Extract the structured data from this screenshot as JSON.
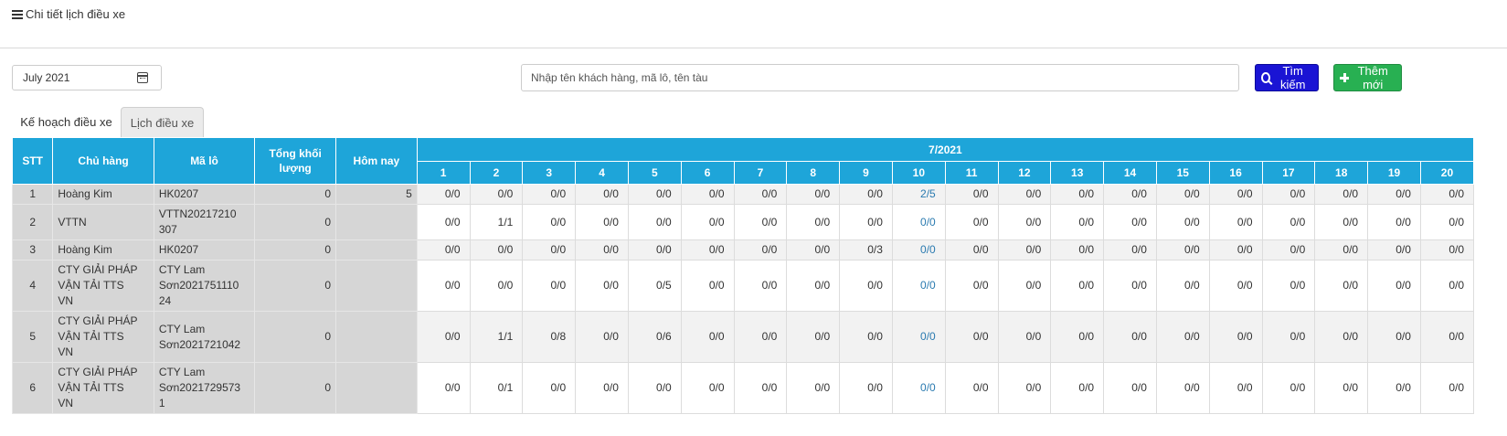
{
  "header": {
    "title": "Chi tiết lịch điều xe",
    "menu_icon": "hamburger-icon"
  },
  "toolbar": {
    "month_value": "July  2021",
    "calendar_icon": "calendar-icon",
    "search_placeholder": "Nhập tên khách hàng, mã lô, tên tàu",
    "search_label": "Tìm kiếm",
    "add_label": "Thêm mới"
  },
  "tabs": [
    {
      "label": "Kế hoạch điều xe",
      "active": false
    },
    {
      "label": "Lịch điều xe",
      "active": true
    }
  ],
  "colors": {
    "header_bg": "#1ea5d9",
    "search_btn": "#1a14d4",
    "add_btn": "#28b052",
    "link": "#2a7ab0",
    "info_bg": "#d6d6d6"
  },
  "table": {
    "columns": {
      "stt": "STT",
      "owner": "Chủ hàng",
      "lot": "Mã lô",
      "total_line1": "Tổng khối",
      "total_line2": "lượng",
      "today": "Hôm nay"
    },
    "month_label": "7/2021",
    "days": [
      "1",
      "2",
      "3",
      "4",
      "5",
      "6",
      "7",
      "8",
      "9",
      "10",
      "11",
      "12",
      "13",
      "14",
      "15",
      "16",
      "17",
      "18",
      "19",
      "20"
    ],
    "rows": [
      {
        "stt": "1",
        "owner": [
          "Hoàng Kim"
        ],
        "lot": [
          "HK0207"
        ],
        "total": "0",
        "today": "5",
        "cells": [
          "0/0",
          "0/0",
          "0/0",
          "0/0",
          "0/0",
          "0/0",
          "0/0",
          "0/0",
          "0/0",
          "2/5",
          "0/0",
          "0/0",
          "0/0",
          "0/0",
          "0/0",
          "0/0",
          "0/0",
          "0/0",
          "0/0",
          "0/0"
        ]
      },
      {
        "stt": "2",
        "owner": [
          "VTTN"
        ],
        "lot": [
          "VTTN20217210",
          "307"
        ],
        "total": "0",
        "today": "",
        "cells": [
          "0/0",
          "1/1",
          "0/0",
          "0/0",
          "0/0",
          "0/0",
          "0/0",
          "0/0",
          "0/0",
          "0/0",
          "0/0",
          "0/0",
          "0/0",
          "0/0",
          "0/0",
          "0/0",
          "0/0",
          "0/0",
          "0/0",
          "0/0"
        ]
      },
      {
        "stt": "3",
        "owner": [
          "Hoàng Kim"
        ],
        "lot": [
          "HK0207"
        ],
        "total": "0",
        "today": "",
        "cells": [
          "0/0",
          "0/0",
          "0/0",
          "0/0",
          "0/0",
          "0/0",
          "0/0",
          "0/0",
          "0/3",
          "0/0",
          "0/0",
          "0/0",
          "0/0",
          "0/0",
          "0/0",
          "0/0",
          "0/0",
          "0/0",
          "0/0",
          "0/0"
        ]
      },
      {
        "stt": "4",
        "owner": [
          "CTY GIẢI PHÁP",
          "VẬN TẢI TTS",
          "VN"
        ],
        "lot": [
          "CTY Lam",
          "Sơn2021751110",
          "24"
        ],
        "total": "0",
        "today": "",
        "cells": [
          "0/0",
          "0/0",
          "0/0",
          "0/0",
          "0/5",
          "0/0",
          "0/0",
          "0/0",
          "0/0",
          "0/0",
          "0/0",
          "0/0",
          "0/0",
          "0/0",
          "0/0",
          "0/0",
          "0/0",
          "0/0",
          "0/0",
          "0/0"
        ]
      },
      {
        "stt": "5",
        "owner": [
          "CTY GIẢI PHÁP",
          "VẬN TẢI TTS",
          "VN"
        ],
        "lot": [
          "CTY Lam",
          "Sơn2021721042"
        ],
        "total": "0",
        "today": "",
        "cells": [
          "0/0",
          "1/1",
          "0/8",
          "0/0",
          "0/6",
          "0/0",
          "0/0",
          "0/0",
          "0/0",
          "0/0",
          "0/0",
          "0/0",
          "0/0",
          "0/0",
          "0/0",
          "0/0",
          "0/0",
          "0/0",
          "0/0",
          "0/0"
        ]
      },
      {
        "stt": "6",
        "owner": [
          "CTY GIẢI PHÁP",
          "VẬN TẢI TTS",
          "VN"
        ],
        "lot": [
          "CTY Lam",
          "Sơn2021729573",
          "1"
        ],
        "total": "0",
        "today": "",
        "cells": [
          "0/0",
          "0/1",
          "0/0",
          "0/0",
          "0/0",
          "0/0",
          "0/0",
          "0/0",
          "0/0",
          "0/0",
          "0/0",
          "0/0",
          "0/0",
          "0/0",
          "0/0",
          "0/0",
          "0/0",
          "0/0",
          "0/0",
          "0/0"
        ]
      }
    ]
  }
}
